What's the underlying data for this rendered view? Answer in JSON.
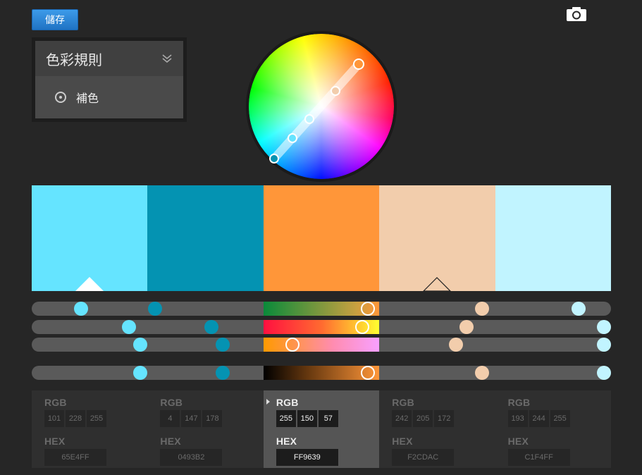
{
  "toolbar": {
    "save_label": "儲存",
    "camera_icon": "camera-icon"
  },
  "rules": {
    "title": "色彩規則",
    "selected": "補色"
  },
  "swatches": [
    {
      "color": "#65E4FF",
      "marker": "base"
    },
    {
      "color": "#0493B2",
      "marker": ""
    },
    {
      "color": "#FF9639",
      "marker": ""
    },
    {
      "color": "#F2CDAC",
      "marker": "outline"
    },
    {
      "color": "#C1F4FF",
      "marker": ""
    }
  ],
  "colors": [
    {
      "rgb_label": "RGB",
      "r": "101",
      "g": "228",
      "b": "255",
      "hex_label": "HEX",
      "hex": "65E4FF",
      "active": false
    },
    {
      "rgb_label": "RGB",
      "r": "4",
      "g": "147",
      "b": "178",
      "hex_label": "HEX",
      "hex": "0493B2",
      "active": false
    },
    {
      "rgb_label": "RGB",
      "r": "255",
      "g": "150",
      "b": "57",
      "hex_label": "HEX",
      "hex": "FF9639",
      "active": true
    },
    {
      "rgb_label": "RGB",
      "r": "242",
      "g": "205",
      "b": "172",
      "hex_label": "HEX",
      "hex": "F2CDAC",
      "active": false
    },
    {
      "rgb_label": "RGB",
      "r": "193",
      "g": "244",
      "b": "255",
      "hex_label": "HEX",
      "hex": "C1F4FF",
      "active": false
    }
  ],
  "slider_levels": [
    [
      0.085,
      0.213,
      0.58,
      0.777,
      0.944
    ],
    [
      0.168,
      0.31,
      0.57,
      0.75,
      0.988
    ],
    [
      0.187,
      0.33,
      0.45,
      0.732,
      1.0
    ],
    [
      0.187,
      0.33,
      0.58,
      0.777,
      1.0
    ]
  ]
}
